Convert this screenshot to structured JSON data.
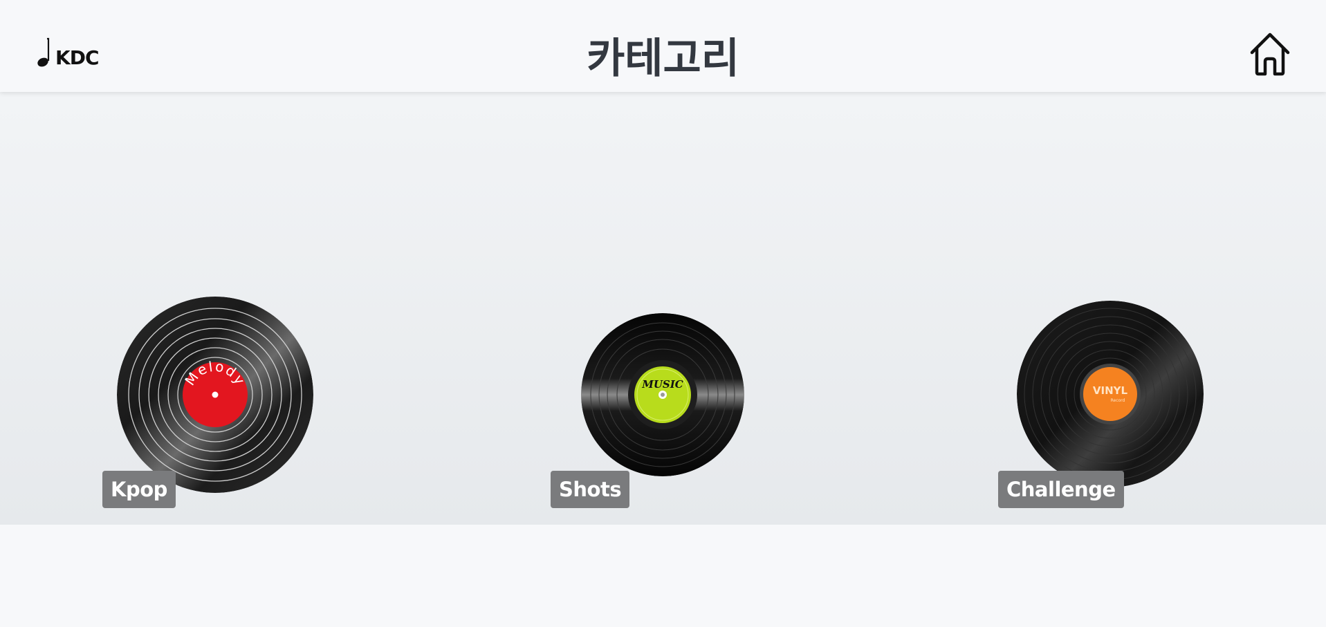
{
  "header": {
    "logo_text": "KDC",
    "title": "카테고리",
    "home_icon": "home-icon",
    "note_icon": "music-note-icon"
  },
  "categories": [
    {
      "label": "Kpop",
      "record_label_text": "Melody",
      "label_color": "#e3161f"
    },
    {
      "label": "Shots",
      "record_label_text": "MUSIC",
      "label_color": "#b8dc1c"
    },
    {
      "label": "Challenge",
      "record_label_text": "VINYL",
      "record_label_subtext": "Record",
      "label_color": "#f58220"
    }
  ]
}
